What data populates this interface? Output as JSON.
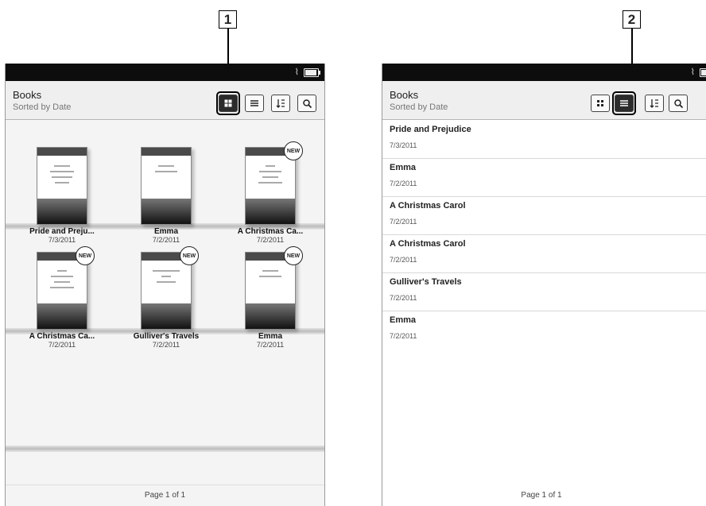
{
  "callouts": [
    "1",
    "2"
  ],
  "header": {
    "title": "Books",
    "subtitle": "Sorted by Date"
  },
  "status": {
    "wifi_label": "Wi-Fi"
  },
  "toolbar": {
    "thumbnail_icon": "grid-icon",
    "list_icon": "list-icon",
    "sort_icon": "sort-icon",
    "search_icon": "search-icon"
  },
  "new_badge": "NEW",
  "books": [
    {
      "title": "Pride and Preju...",
      "date": "7/3/2011",
      "new": false
    },
    {
      "title": "Emma",
      "date": "7/2/2011",
      "new": false
    },
    {
      "title": "A Christmas Ca...",
      "date": "7/2/2011",
      "new": true
    },
    {
      "title": "A Christmas Ca...",
      "date": "7/2/2011",
      "new": true
    },
    {
      "title": "Gulliver's Travels",
      "date": "7/2/2011",
      "new": true
    },
    {
      "title": "Emma",
      "date": "7/2/2011",
      "new": true
    }
  ],
  "list": [
    {
      "title": "Pride and Prejudice",
      "date": "7/3/2011",
      "new": false
    },
    {
      "title": "Emma",
      "date": "7/2/2011",
      "new": false
    },
    {
      "title": "A Christmas Carol",
      "date": "7/2/2011",
      "new": true
    },
    {
      "title": "A Christmas Carol",
      "date": "7/2/2011",
      "new": true
    },
    {
      "title": "Gulliver's Travels",
      "date": "7/2/2011",
      "new": true
    },
    {
      "title": "Emma",
      "date": "7/2/2011",
      "new": true
    }
  ],
  "footer": {
    "page_label": "Page 1 of 1"
  }
}
